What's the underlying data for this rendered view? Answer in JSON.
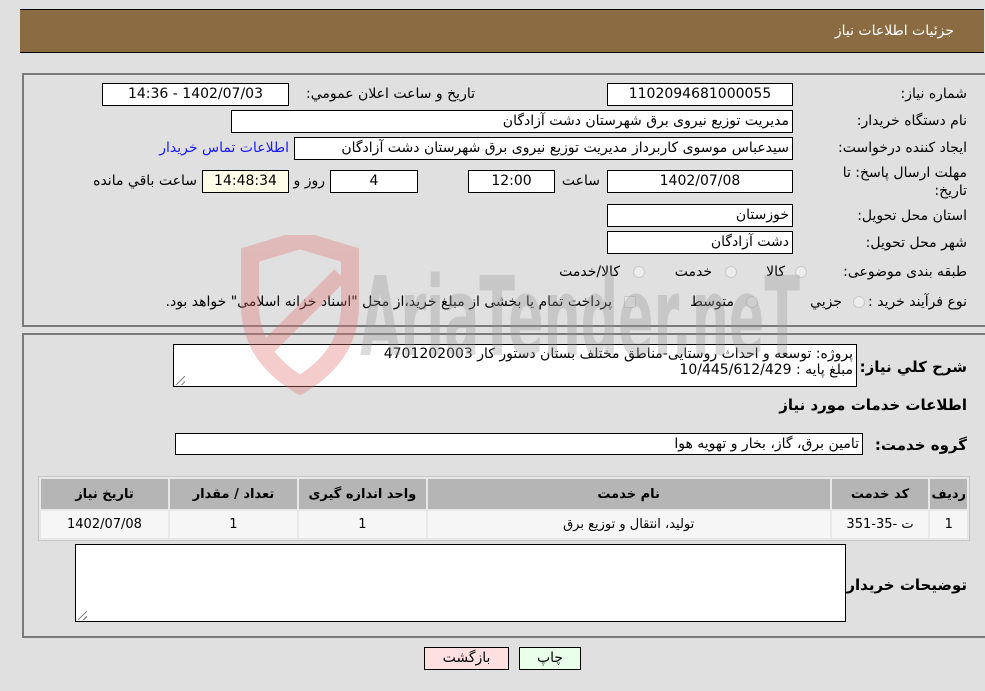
{
  "header": {
    "title": "جزئیات اطلاعات نیاز"
  },
  "form": {
    "need_number_label": "شماره نیاز:",
    "need_number": "1102094681000055",
    "announce_label": "تاریخ و ساعت اعلان عمومي:",
    "announce_value": "1402/07/03 - 14:36",
    "buyer_org_label": "نام دستگاه خریدار:",
    "buyer_org": "مدیریت توزیع نیروی برق شهرستان دشت آزادگان",
    "creator_label": "ایجاد کننده درخواست:",
    "creator": "سیدعباس موسوی کاربرداز مدیریت توزیع نیروی برق شهرستان دشت آزادگان",
    "contact_link": "اطلاعات تماس خریدار",
    "deadline_label_line1": "مهلت ارسال پاسخ: تا",
    "deadline_label_line2": "تاریخ:",
    "deadline_date": "1402/07/08",
    "time_label": "ساعت",
    "deadline_time": "12:00",
    "days_value": "4",
    "days_label": "روز و",
    "remaining_time": "14:48:34",
    "remaining_label": "ساعت باقي مانده",
    "province_label": "استان محل تحویل:",
    "province": "خوزستان",
    "city_label": "شهر محل تحویل:",
    "city": "دشت آزادگان",
    "category_label": "طبقه بندی موضوعی:",
    "category_options": [
      "کالا",
      "خدمت",
      "کالا/خدمت"
    ],
    "category_selected": "",
    "process_label": "نوع فرآیند خرید :",
    "process_options": [
      "جزيي",
      "متوسط"
    ],
    "process_selected": "",
    "treasury_note": "پرداخت تمام یا بخشی از مبلغ خرید،از محل \"اسناد خزانه اسلامی\" خواهد بود.",
    "treasury_checked": false
  },
  "description": {
    "label": "شرح کلي نیاز:",
    "line1": "پروژه: توسعه و احداث روستایی-مناطق مختلف بستان دستور کار 4701202003",
    "line2": "مبلغ پایه : 10/445/612/429"
  },
  "services": {
    "section_title": "اطلاعات خدمات مورد نیاز",
    "group_label": "گروه خدمت:",
    "group_value": "تامین برق، گاز، بخار و تهویه هوا",
    "columns": [
      "ردیف",
      "کد خدمت",
      "نام خدمت",
      "واحد اندازه گیری",
      "تعداد / مقدار",
      "تاریخ نیاز"
    ],
    "rows": [
      [
        "1",
        "ت -35-351",
        "تولید، انتقال و توزیع برق",
        "1",
        "1",
        "1402/07/08"
      ]
    ]
  },
  "buyer_notes": {
    "label": "توضیحات خریدار:",
    "value": ""
  },
  "buttons": {
    "print": "چاپ",
    "back": "بازگشت"
  },
  "watermark": {
    "text": "AriaTender.neT"
  }
}
